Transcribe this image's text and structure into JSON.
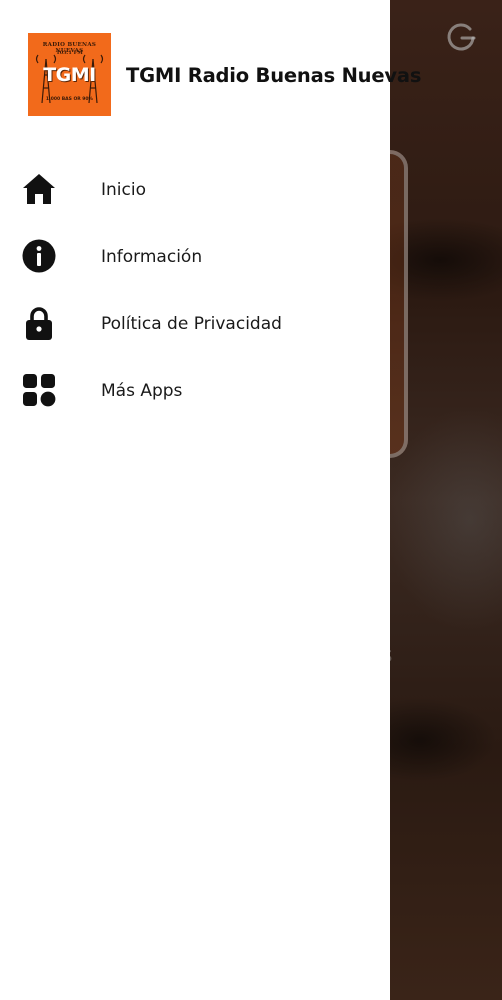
{
  "header": {
    "logo": {
      "line1": "RADIO BUENAS NUEVAS",
      "line2": "103.1 FM",
      "main": "TGMI",
      "line3": "1,000 BAS OR 90%"
    },
    "title": "TGMI Radio Buenas Nuevas"
  },
  "menu": {
    "items": [
      {
        "label": "Inicio",
        "icon": "home-icon"
      },
      {
        "label": "Información",
        "icon": "info-icon"
      },
      {
        "label": "Política de Privacidad",
        "icon": "lock-icon"
      },
      {
        "label": "Más Apps",
        "icon": "apps-icon"
      }
    ]
  },
  "background": {
    "partial_text": "s"
  },
  "colors": {
    "logo_bg": "#f26a1b",
    "drawer_bg": "#ffffff",
    "icon": "#111111",
    "scrim": "#2a1a12"
  }
}
